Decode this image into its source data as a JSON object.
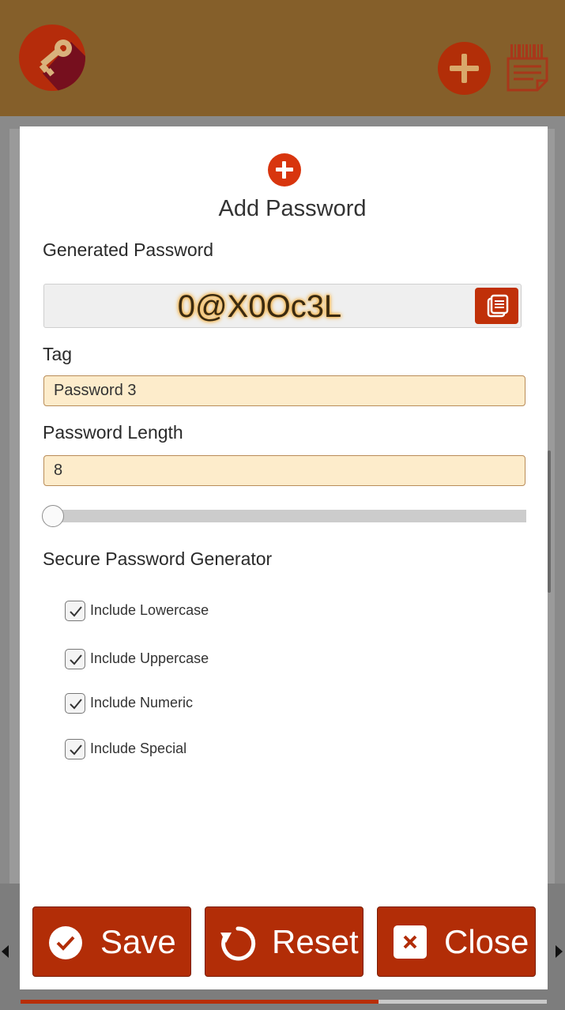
{
  "header": {
    "logo_icon": "key-icon",
    "add_icon": "plus-icon",
    "notes_icon": "barcode-notes-icon",
    "accent": "#855f2a"
  },
  "modal": {
    "title": "Add Password",
    "title_icon": "plus-icon",
    "generated_label": "Generated Password",
    "generated_value": "0@X0Oc3L",
    "copy_icon": "copy-icon",
    "tag_label": "Tag",
    "tag_value": "Password 3",
    "length_label": "Password Length",
    "length_value": "8",
    "slider_fraction": 0.0,
    "generator_heading": "Secure Password Generator",
    "options": [
      {
        "label": "Include Lowercase",
        "checked": true
      },
      {
        "label": "Include Uppercase",
        "checked": true
      },
      {
        "label": "Include Numeric",
        "checked": true
      },
      {
        "label": "Include Special",
        "checked": true
      }
    ]
  },
  "actions": {
    "save_label": "Save",
    "reset_label": "Reset",
    "close_label": "Close"
  },
  "progress": {
    "fraction": 0.68
  },
  "colors": {
    "primary": "#b22d07",
    "field_bg": "#fdeccb",
    "password_glow": "#f2b24a"
  }
}
